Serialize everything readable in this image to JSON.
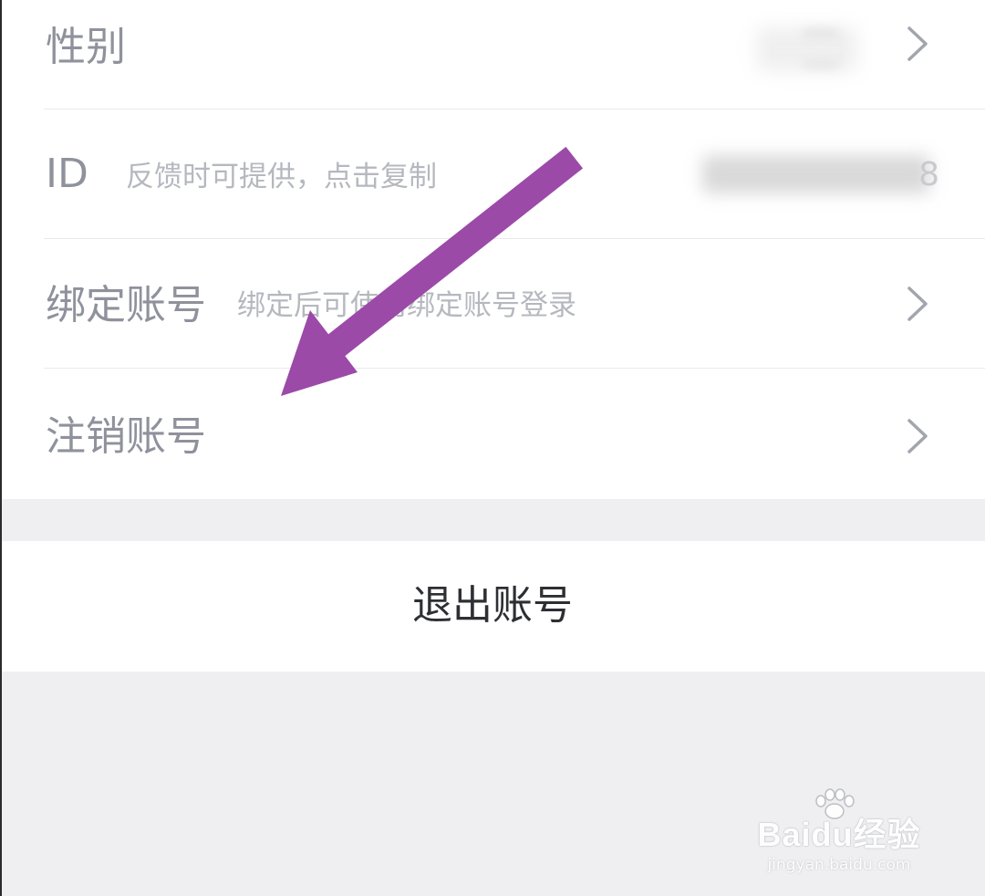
{
  "settings": {
    "gender": {
      "label": "性别"
    },
    "id": {
      "label": "ID",
      "hint": "反馈时可提供，点击复制",
      "value_tail": "8"
    },
    "bind": {
      "label": "绑定账号",
      "hint": "绑定后可使用绑定账号登录"
    },
    "cancel": {
      "label": "注销账号"
    }
  },
  "logout": {
    "label": "退出账号"
  },
  "annotation": {
    "color": "#9b4aa8"
  },
  "watermark": {
    "logo": "Baidu经验",
    "url": "jingyan.baidu.com"
  },
  "icons": {
    "chevron": "chevron-right-icon"
  }
}
